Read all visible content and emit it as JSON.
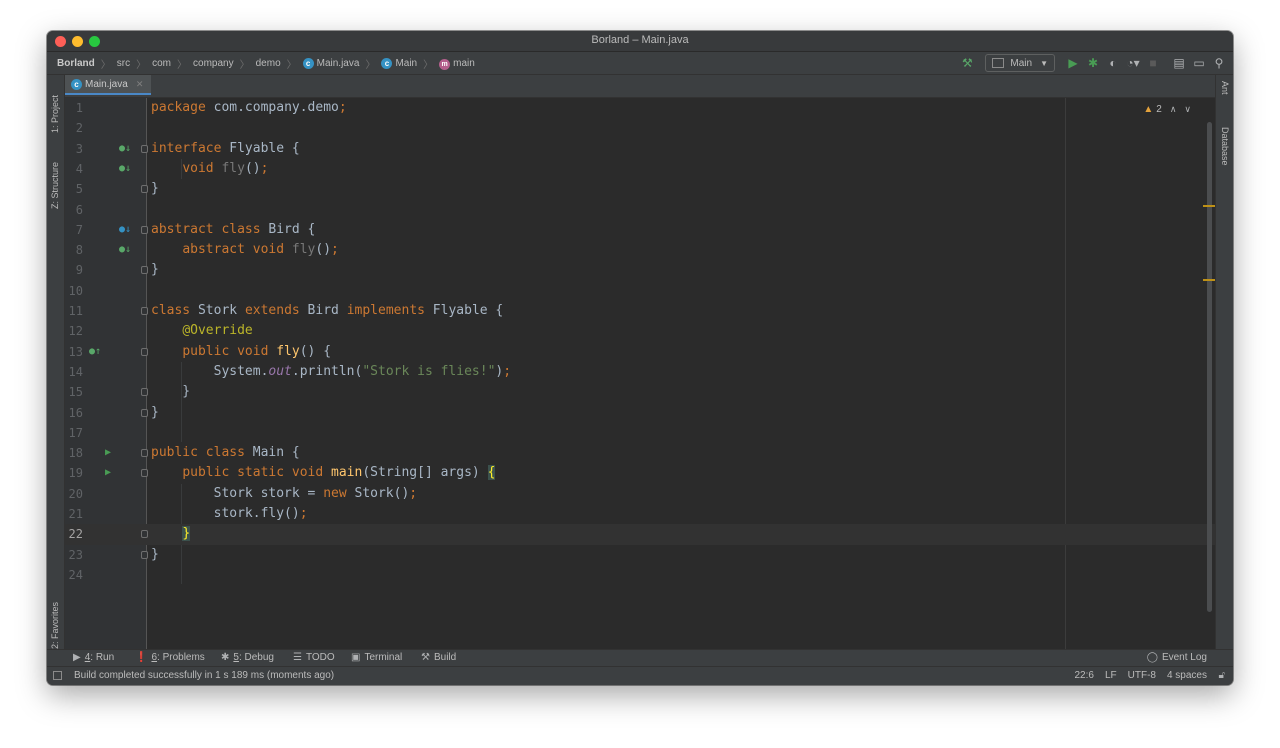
{
  "window": {
    "title": "Borland – Main.java"
  },
  "breadcrumbs": [
    {
      "label": "Borland",
      "bold": true
    },
    {
      "label": "src"
    },
    {
      "label": "com"
    },
    {
      "label": "company"
    },
    {
      "label": "demo"
    },
    {
      "label": "Main.java",
      "icon": "class-icon"
    },
    {
      "label": "Main",
      "icon": "class-icon"
    },
    {
      "label": "main",
      "icon": "method-icon"
    }
  ],
  "toolbar": {
    "run_config": "Main"
  },
  "left_tools": {
    "project": "1: Project",
    "structure": "Z: Structure",
    "favorites": "2: Favorites"
  },
  "right_tools": {
    "ant": "Ant",
    "database": "Database"
  },
  "editor": {
    "tab_label": "Main.java",
    "warning_count": "2",
    "current_line": 22,
    "lines": [
      {
        "n": "1",
        "html": "<span class='kw'>package</span> com.company.demo<span class='kw'>;</span>"
      },
      {
        "n": "2",
        "html": ""
      },
      {
        "n": "3",
        "html": "<span class='kw'>interface</span> Flyable {",
        "gut": "impl"
      },
      {
        "n": "4",
        "html": "    <span class='kw'>void</span> <span class='dim'>fly</span>()<span class='kw'>;</span>",
        "gut": "impl"
      },
      {
        "n": "5",
        "html": "}"
      },
      {
        "n": "6",
        "html": ""
      },
      {
        "n": "7",
        "html": "<span class='kw'>abstract class</span> Bird {",
        "gut": "iface"
      },
      {
        "n": "8",
        "html": "    <span class='kw'>abstract void</span> <span class='dim'>fly</span>()<span class='kw'>;</span>",
        "gut": "impl"
      },
      {
        "n": "9",
        "html": "}"
      },
      {
        "n": "10",
        "html": ""
      },
      {
        "n": "11",
        "html": "<span class='kw'>class</span> Stork <span class='kw'>extends</span> Bird <span class='kw'>implements</span> Flyable {"
      },
      {
        "n": "12",
        "html": "    <span class='ann'>@Override</span>"
      },
      {
        "n": "13",
        "html": "    <span class='kw'>public void</span> <span class='fn'>fly</span>() {",
        "gut": "override"
      },
      {
        "n": "14",
        "html": "        System.<span class='fld'>out</span>.println(<span class='str'>\"Stork is flies!\"</span>)<span class='kw'>;</span>"
      },
      {
        "n": "15",
        "html": "    }"
      },
      {
        "n": "16",
        "html": "}"
      },
      {
        "n": "17",
        "html": ""
      },
      {
        "n": "18",
        "html": "<span class='kw'>public class</span> Main {",
        "gut": "run"
      },
      {
        "n": "19",
        "html": "    <span class='kw'>public static void</span> <span class='fn'>main</span>(String[] args) <span class='brace-hl'>{</span>",
        "gut": "run"
      },
      {
        "n": "20",
        "html": "        Stork stork = <span class='kw'>new</span> Stork()<span class='kw'>;</span>"
      },
      {
        "n": "21",
        "html": "        stork.fly()<span class='kw'>;</span>"
      },
      {
        "n": "22",
        "html": "    <span class='brace-hl'>}</span>"
      },
      {
        "n": "23",
        "html": "}"
      },
      {
        "n": "24",
        "html": ""
      }
    ]
  },
  "bottom_tools": [
    {
      "icon": "run-icon",
      "glyph": "▶",
      "key": "4",
      "label": ": Run"
    },
    {
      "icon": "problems-icon",
      "glyph": "❗",
      "key": "6",
      "label": ": Problems"
    },
    {
      "icon": "debug-icon",
      "glyph": "✱",
      "key": "5",
      "label": ": Debug"
    },
    {
      "icon": "todo-icon",
      "glyph": "☰",
      "key": "",
      "label": "TODO"
    },
    {
      "icon": "terminal-icon",
      "glyph": "▣",
      "key": "",
      "label": "Terminal"
    },
    {
      "icon": "build-icon",
      "glyph": "⚒",
      "key": "",
      "label": "Build"
    }
  ],
  "event_log": "Event Log",
  "status": {
    "message": "Build completed successfully in 1 s 189 ms (moments ago)",
    "position": "22:6",
    "line_sep": "LF",
    "encoding": "UTF-8",
    "indent": "4 spaces"
  },
  "colors": {
    "keyword": "#cc7832",
    "function": "#ffc66d",
    "string": "#6a8759",
    "annotation": "#bbb529",
    "field": "#9876aa",
    "text": "#a9b7c6"
  }
}
